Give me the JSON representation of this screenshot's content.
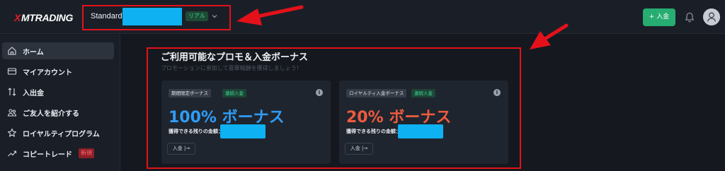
{
  "header": {
    "logo_mark": "X",
    "logo_text": "MTRADING",
    "account_type": "Standard",
    "account_mode_badge": "リアル",
    "deposit_button": "+ 入金"
  },
  "sidebar": {
    "items": [
      {
        "label": "ホーム",
        "icon": "home-icon",
        "active": true
      },
      {
        "label": "マイアカウント",
        "icon": "card-icon"
      },
      {
        "label": "入出金",
        "icon": "transfer-icon"
      },
      {
        "label": "ご友人を紹介する",
        "icon": "people-icon"
      },
      {
        "label": "ロイヤルティプログラム",
        "icon": "star-icon"
      },
      {
        "label": "コピートレード",
        "icon": "trend-icon",
        "badge": "新規"
      }
    ]
  },
  "promo": {
    "title": "ご利用可能なプロモ＆入金ボーナス",
    "subtitle": "プロモーションに参加して豪華報酬を獲得しましょう！",
    "cards": [
      {
        "tag": "期間限定ボーナス",
        "type_tag": "連続入金",
        "headline": "100% ボーナス",
        "headline_color": "#2f9cf5",
        "remaining_label": "獲得できる残りの金額：",
        "button": "入金 |→"
      },
      {
        "tag": "ロイヤルティ入金ボーナス",
        "type_tag": "連続入金",
        "headline": "20% ボーナス",
        "headline_color": "#ee5b3f",
        "remaining_label": "獲得できる残りの金額：",
        "button": "入金 |→"
      }
    ]
  },
  "colors": {
    "background": "#15191f",
    "panel": "#1a1f27",
    "card": "#1f252e",
    "accent_green": "#27ad72",
    "annotation_red": "#e4111a",
    "redaction_blue": "#0eb1f2"
  }
}
